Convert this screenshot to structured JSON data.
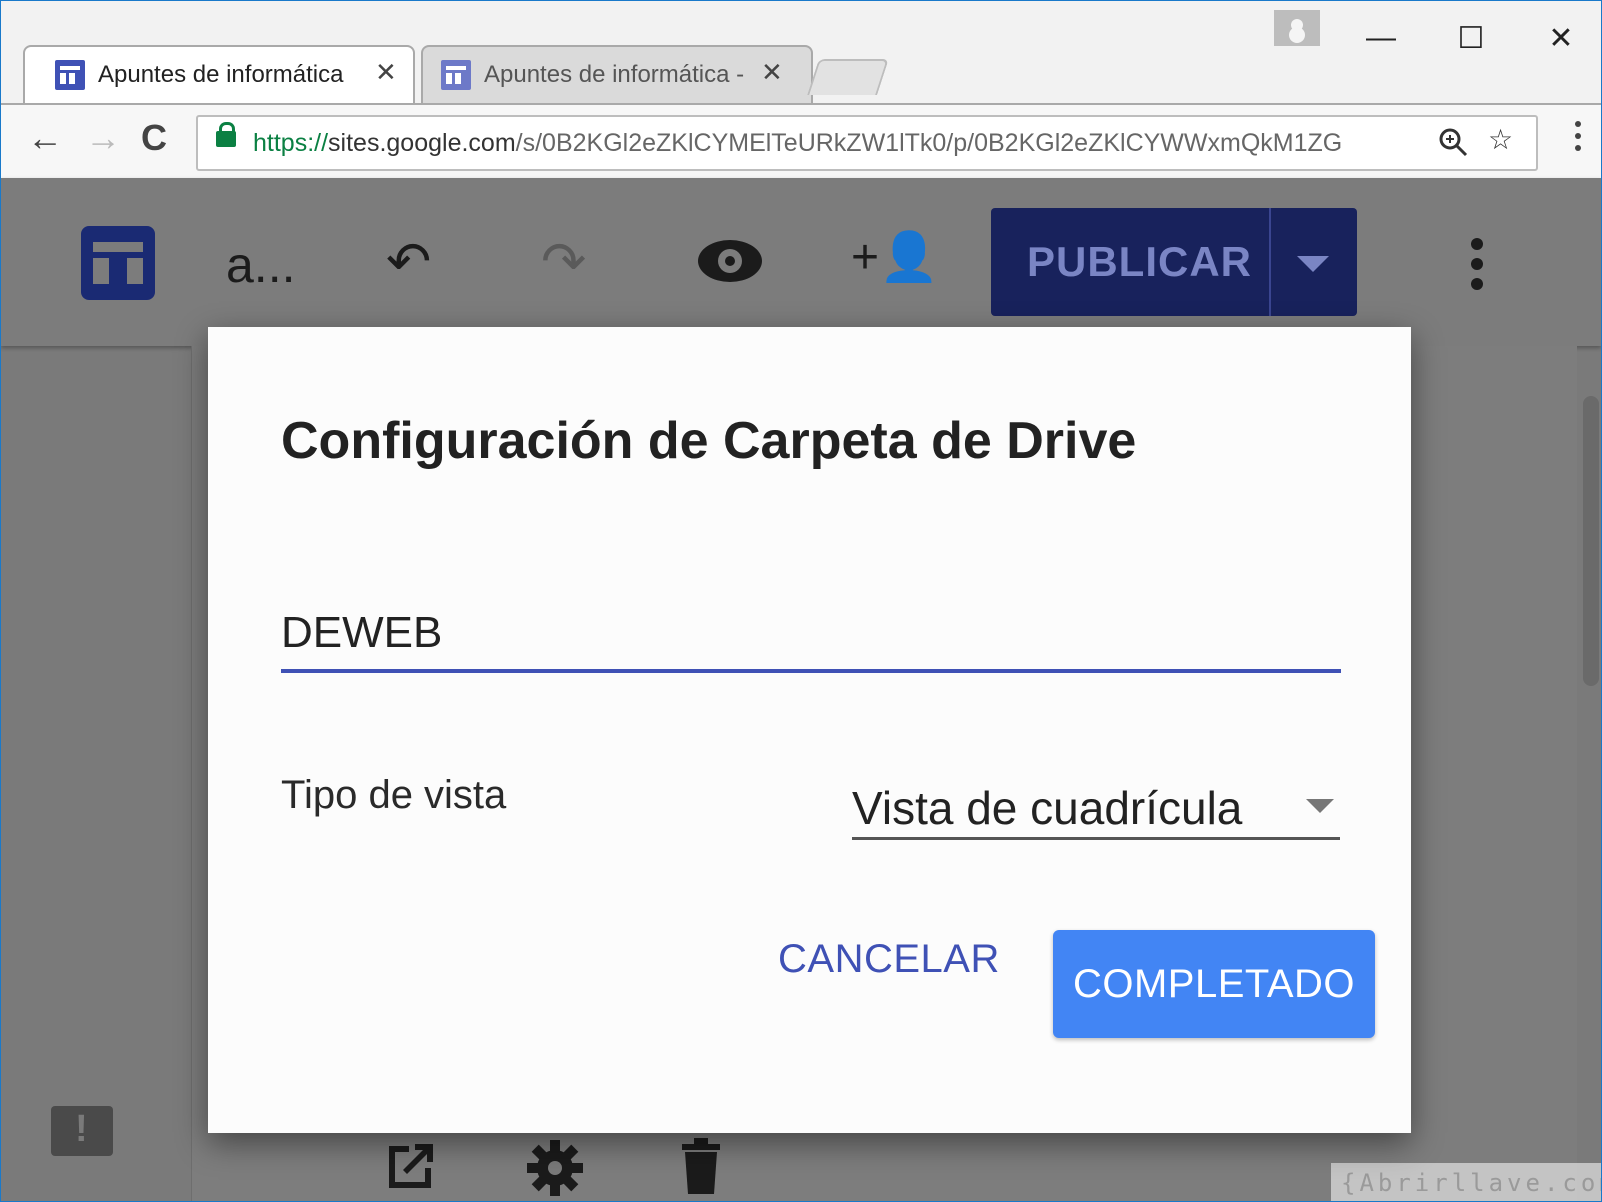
{
  "browser": {
    "tabs": [
      {
        "title": "Apuntes de informática",
        "close": "✕",
        "active": true
      },
      {
        "title": "Apuntes de informática -",
        "close": "✕",
        "active": false
      }
    ],
    "window_controls": {
      "minimize": "—",
      "maximize": "☐",
      "close": "✕"
    },
    "nav": {
      "back": "←",
      "forward": "→",
      "reload": "C"
    },
    "url": {
      "protocol": "https://",
      "host": "sites.google.com",
      "path": "/s/0B2KGl2eZKlCYMElTeURkZW1lTk0/p/0B2KGl2eZKlCYWWxmQkM1ZG"
    },
    "icons": {
      "zoom": "zoom-icon",
      "bookmark": "star-icon",
      "menu": "more-vert-icon",
      "lock": "lock-icon"
    }
  },
  "editor": {
    "site_name": "a...",
    "publish_label": "PUBLICAR",
    "icons": {
      "undo": "↶",
      "redo": "↷",
      "add_person": "+👤"
    }
  },
  "dialog": {
    "title": "Configuración de Carpeta de Drive",
    "folder_name_value": "DEWEB",
    "view_type_label": "Tipo de vista",
    "view_type_value": "Vista de cuadrícula",
    "cancel_label": "CANCELAR",
    "done_label": "COMPLETADO"
  },
  "watermark": "{Abrirllave.com",
  "colors": {
    "accent": "#3f51b5",
    "primary_button": "#4285f4",
    "secure_green": "#0b8043"
  }
}
